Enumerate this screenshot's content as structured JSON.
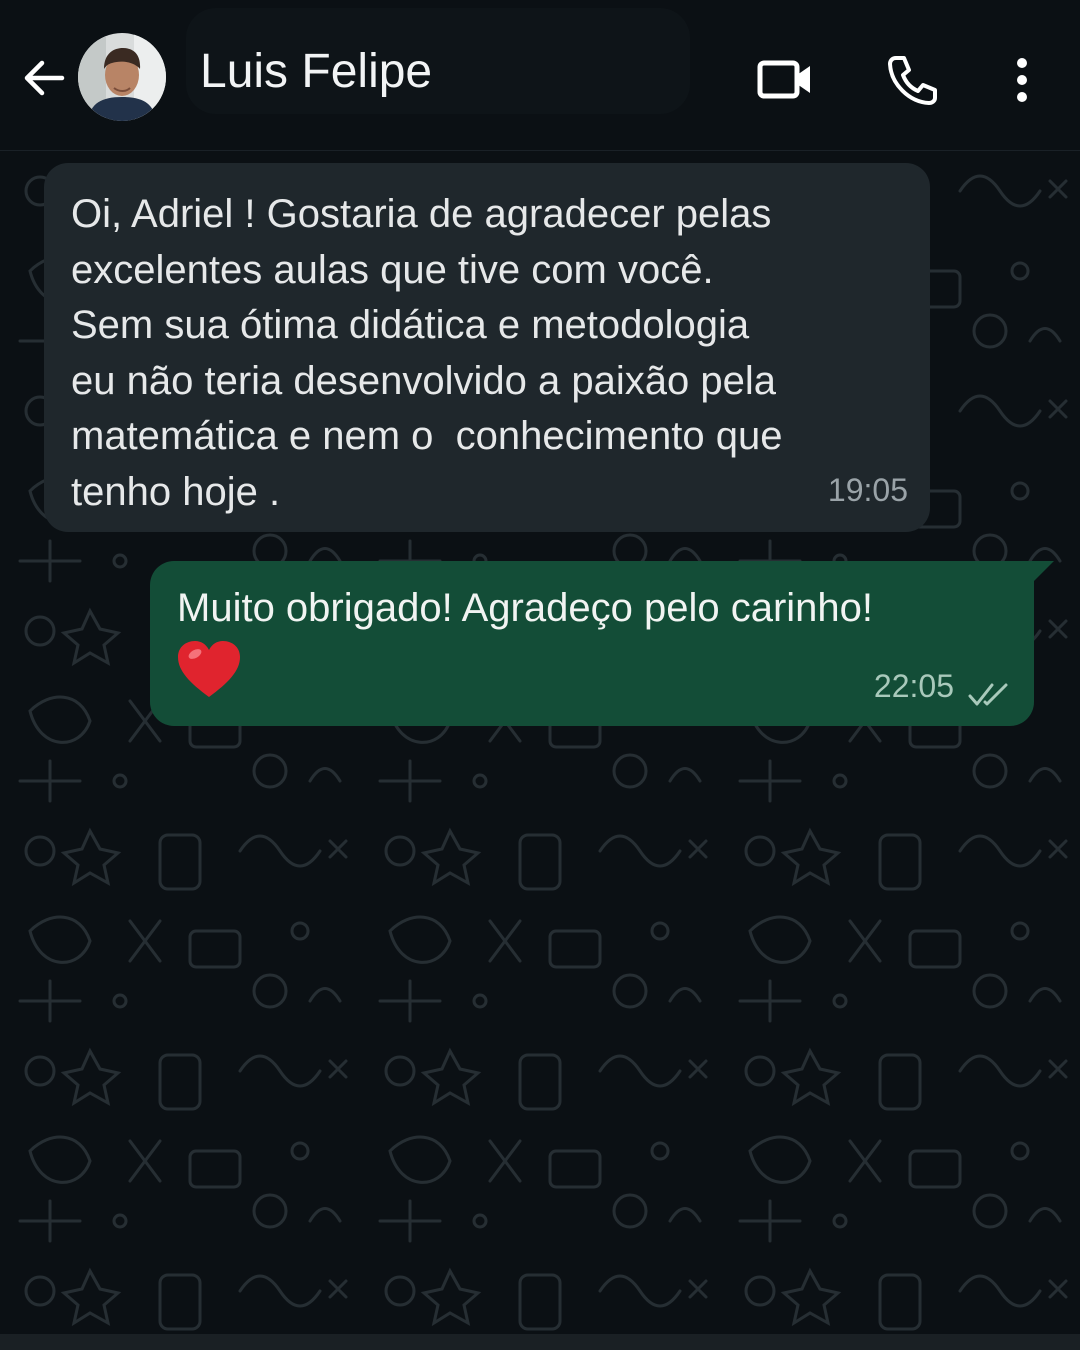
{
  "app": {
    "accent_color": "#134d37",
    "background_color": "#0b1014"
  },
  "header": {
    "back_icon": "arrow-left-icon",
    "contact_name": "Luis Felipe",
    "video_icon": "video-camera-icon",
    "call_icon": "phone-icon",
    "menu_icon": "more-vertical-icon"
  },
  "messages": [
    {
      "direction": "incoming",
      "text": "Oi, Adriel ! Gostaria de agradecer pelas\nexcelentes aulas que tive com você.\nSem sua ótima didática e metodologia\neu não teria desenvolvido a paixão pela\nmatemática e nem o  conhecimento que\ntenho hoje .",
      "time": "19:05",
      "bubble_color": "#1f272c"
    },
    {
      "direction": "outgoing",
      "text": "Muito obrigado! Agradeço pelo carinho!",
      "emoji": "red-heart",
      "time": "22:05",
      "status_icon": "double-check-icon",
      "bubble_color": "#134d37"
    }
  ]
}
